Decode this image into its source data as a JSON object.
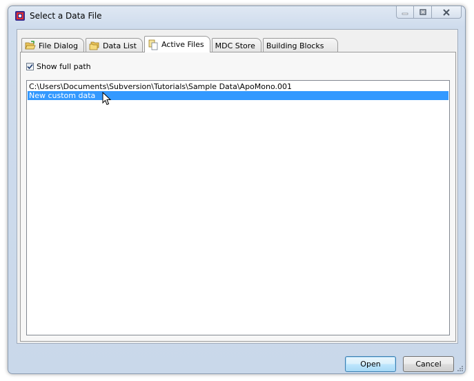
{
  "window": {
    "title": "Select a Data File",
    "app_icon": "fcs-express-icon"
  },
  "window_controls": {
    "minimize": "minimize-icon",
    "maximize": "restore-icon",
    "close": "close-icon"
  },
  "tabs": [
    {
      "label": "File Dialog",
      "icon": "folder-open-icon",
      "active": false
    },
    {
      "label": "Data List",
      "icon": "folders-icon",
      "active": false
    },
    {
      "label": "Active Files",
      "icon": "documents-icon",
      "active": true
    },
    {
      "label": "MDC Store",
      "icon": "",
      "active": false
    },
    {
      "label": "Building Blocks",
      "icon": "",
      "active": false
    }
  ],
  "options": {
    "show_full_path_label": "Show full path",
    "show_full_path_checked": true
  },
  "file_list": {
    "items": [
      {
        "text": "C:\\Users\\Documents\\Subversion\\Tutorials\\Sample Data\\ApoMono.001",
        "selected": false
      },
      {
        "text": "New custom data",
        "selected": true
      }
    ]
  },
  "buttons": {
    "open_label": "Open",
    "cancel_label": "Cancel"
  },
  "colors": {
    "selection": "#3399ff",
    "title_bar": "#cfdced"
  }
}
